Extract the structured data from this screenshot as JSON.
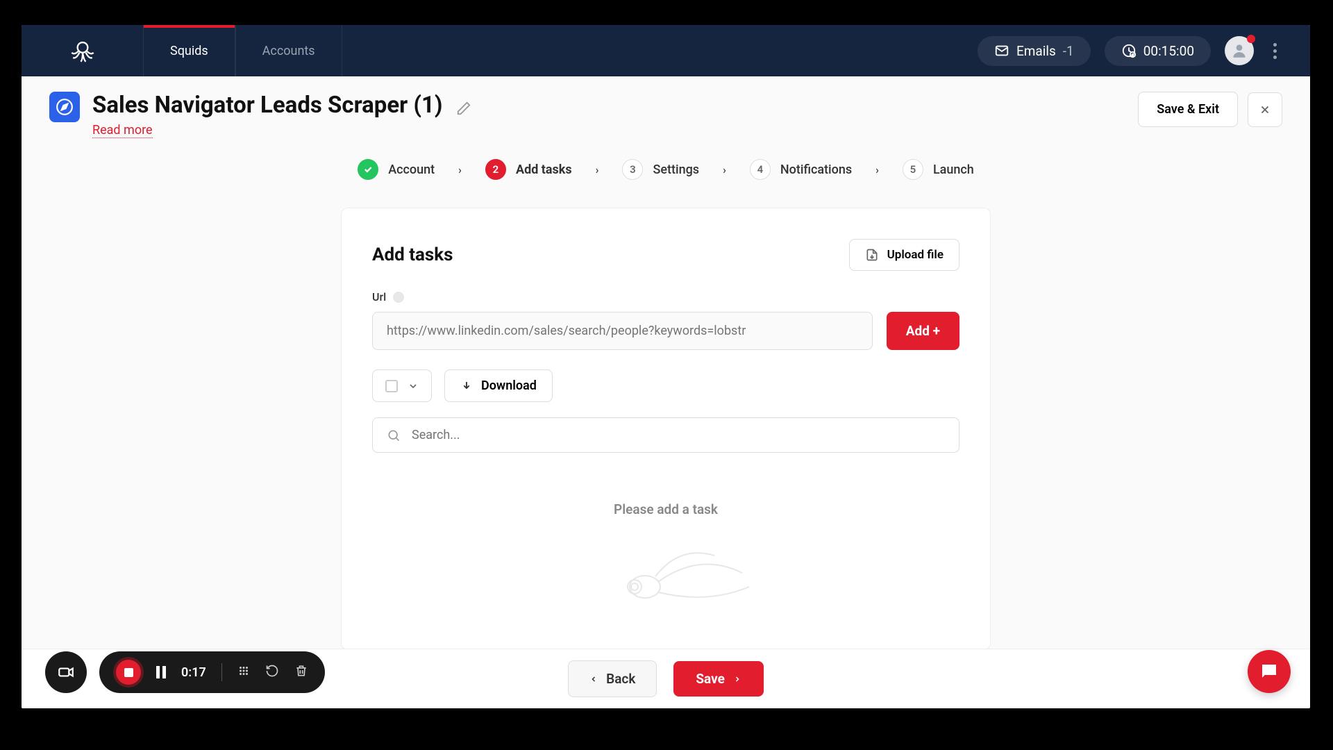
{
  "nav": {
    "tabs": [
      "Squids",
      "Accounts"
    ],
    "activeIndex": 0
  },
  "topbar": {
    "emails_label": "Emails",
    "emails_count": "-1",
    "timer": "00:15:00"
  },
  "page": {
    "title": "Sales Navigator Leads Scraper (1)",
    "read_more": "Read more",
    "save_exit": "Save & Exit"
  },
  "stepper": [
    {
      "num": "✓",
      "label": "Account",
      "state": "done"
    },
    {
      "num": "2",
      "label": "Add tasks",
      "state": "active"
    },
    {
      "num": "3",
      "label": "Settings",
      "state": ""
    },
    {
      "num": "4",
      "label": "Notifications",
      "state": ""
    },
    {
      "num": "5",
      "label": "Launch",
      "state": ""
    }
  ],
  "card": {
    "title": "Add tasks",
    "upload": "Upload file",
    "url_label": "Url",
    "url_placeholder": "https://www.linkedin.com/sales/search/people?keywords=lobstr",
    "add": "Add +",
    "download": "Download",
    "search_placeholder": "Search...",
    "empty": "Please add a task"
  },
  "footer": {
    "back": "Back",
    "save": "Save"
  },
  "recorder": {
    "time": "0:17"
  }
}
